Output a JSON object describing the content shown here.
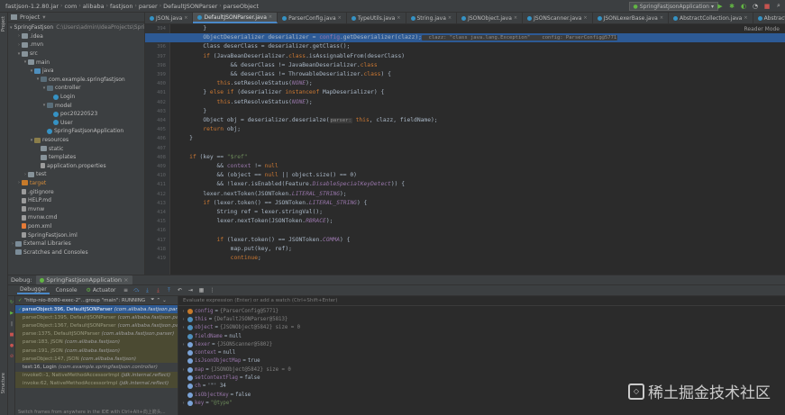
{
  "breadcrumbs": [
    "fastjson-1.2.80.jar",
    "com",
    "alibaba",
    "fastjson",
    "parser",
    "DefaultJSONParser",
    "parseObject"
  ],
  "run_config": "SpringFastjsonApplication",
  "toolbar_icons": [
    "run-icon",
    "debug-icon",
    "coverage-icon",
    "profile-icon",
    "stop-icon",
    "search-icon"
  ],
  "project": {
    "header": "Project",
    "rows": [
      {
        "indent": 0,
        "arrow": "▾",
        "icon": "folder",
        "label": "SpringFastjson",
        "extra": "C:\\Users\\admin\\IdeaProjects\\SpringFastjson"
      },
      {
        "indent": 1,
        "arrow": "›",
        "icon": "folder",
        "label": ".idea",
        "extra": ""
      },
      {
        "indent": 1,
        "arrow": "›",
        "icon": "folder",
        "label": ".mvn",
        "extra": ""
      },
      {
        "indent": 1,
        "arrow": "▾",
        "icon": "folder",
        "label": "src",
        "extra": ""
      },
      {
        "indent": 2,
        "arrow": "▾",
        "icon": "folder",
        "label": "main",
        "extra": ""
      },
      {
        "indent": 3,
        "arrow": "▾",
        "icon": "folder-src",
        "label": "java",
        "extra": ""
      },
      {
        "indent": 4,
        "arrow": "▾",
        "icon": "pkg",
        "label": "com.example.springfastjson",
        "extra": ""
      },
      {
        "indent": 5,
        "arrow": "▾",
        "icon": "pkg",
        "label": "controller",
        "extra": ""
      },
      {
        "indent": 6,
        "arrow": "",
        "icon": "cls",
        "label": "Login",
        "extra": ""
      },
      {
        "indent": 5,
        "arrow": "▾",
        "icon": "pkg",
        "label": "model",
        "extra": ""
      },
      {
        "indent": 6,
        "arrow": "",
        "icon": "cls",
        "label": "poc20220523",
        "extra": ""
      },
      {
        "indent": 6,
        "arrow": "",
        "icon": "cls",
        "label": "User",
        "extra": ""
      },
      {
        "indent": 5,
        "arrow": "",
        "icon": "cls",
        "label": "SpringFastjsonApplication",
        "extra": ""
      },
      {
        "indent": 3,
        "arrow": "▾",
        "icon": "folder-res",
        "label": "resources",
        "extra": ""
      },
      {
        "indent": 4,
        "arrow": "",
        "icon": "folder",
        "label": "static",
        "extra": ""
      },
      {
        "indent": 4,
        "arrow": "",
        "icon": "folder",
        "label": "templates",
        "extra": ""
      },
      {
        "indent": 4,
        "arrow": "",
        "icon": "file",
        "label": "application.properties",
        "extra": ""
      },
      {
        "indent": 2,
        "arrow": "›",
        "icon": "folder",
        "label": "test",
        "extra": ""
      },
      {
        "indent": 1,
        "arrow": "›",
        "icon": "folder-ex",
        "label": "target",
        "extra": ""
      },
      {
        "indent": 1,
        "arrow": "",
        "icon": "file",
        "label": ".gitignore",
        "extra": ""
      },
      {
        "indent": 1,
        "arrow": "",
        "icon": "file",
        "label": "HELP.md",
        "extra": ""
      },
      {
        "indent": 1,
        "arrow": "",
        "icon": "file",
        "label": "mvnw",
        "extra": ""
      },
      {
        "indent": 1,
        "arrow": "",
        "icon": "file",
        "label": "mvnw.cmd",
        "extra": ""
      },
      {
        "indent": 1,
        "arrow": "",
        "icon": "xml",
        "label": "pom.xml",
        "extra": ""
      },
      {
        "indent": 1,
        "arrow": "",
        "icon": "file",
        "label": "SpringFastjson.iml",
        "extra": ""
      },
      {
        "indent": 0,
        "arrow": "›",
        "icon": "lib",
        "label": "External Libraries",
        "extra": ""
      },
      {
        "indent": 0,
        "arrow": "",
        "icon": "lib",
        "label": "Scratches and Consoles",
        "extra": ""
      }
    ]
  },
  "tabs": [
    {
      "label": "JSON.java",
      "active": false,
      "kind": "cls"
    },
    {
      "label": "DefaultJSONParser.java",
      "active": true,
      "kind": "cls"
    },
    {
      "label": "ParserConfig.java",
      "active": false,
      "kind": "cls"
    },
    {
      "label": "TypeUtils.java",
      "active": false,
      "kind": "cls"
    },
    {
      "label": "String.java",
      "active": false,
      "kind": "cls"
    },
    {
      "label": "JSONObject.java",
      "active": false,
      "kind": "cls"
    },
    {
      "label": "JSONScanner.java",
      "active": false,
      "kind": "cls"
    },
    {
      "label": "JSONLexerBase.java",
      "active": false,
      "kind": "cls"
    },
    {
      "label": "AbstractCollection.java",
      "active": false,
      "kind": "cls"
    },
    {
      "label": "AbstractList.java",
      "active": false,
      "kind": "cls"
    }
  ],
  "editor": {
    "reader_mode": "Reader Mode",
    "lines": [
      {
        "num": "394",
        "hl": "",
        "segs": [
          [
            "",
            "        }"
          ]
        ]
      },
      {
        "num": "395",
        "hl": "hl",
        "segs": [
          [
            "",
            "        ObjectDeserializer deserializer = "
          ],
          [
            "fld",
            "config"
          ],
          [
            "",
            ".getDeserializer(clazz);"
          ],
          [
            "inlay",
            "  clazz: \"class java.lang.Exception\"    config: ParserConfig@5771"
          ]
        ]
      },
      {
        "num": "396",
        "hl": "",
        "segs": [
          [
            "",
            "        Class deserClass = deserializer.getClass();"
          ]
        ]
      },
      {
        "num": "397",
        "hl": "",
        "segs": [
          [
            "",
            "        "
          ],
          [
            "kw",
            "if"
          ],
          [
            "",
            " (JavaBeanDeserializer."
          ],
          [
            "kw",
            "class"
          ],
          [
            "",
            ".isAssignableFrom(deserClass)"
          ]
        ]
      },
      {
        "num": "398",
        "hl": "",
        "segs": [
          [
            "",
            "                && deserClass != JavaBeanDeserializer."
          ],
          [
            "kw",
            "class"
          ]
        ]
      },
      {
        "num": "399",
        "hl": "",
        "segs": [
          [
            "",
            "                && deserClass != ThrowableDeserializer."
          ],
          [
            "kw",
            "class"
          ],
          [
            "",
            ") {"
          ]
        ]
      },
      {
        "num": "400",
        "hl": "",
        "segs": [
          [
            "",
            "            "
          ],
          [
            "kw",
            "this"
          ],
          [
            "",
            ".setResolveStatus("
          ],
          [
            "ital",
            "NONE"
          ],
          [
            "",
            ");"
          ]
        ]
      },
      {
        "num": "401",
        "hl": "",
        "segs": [
          [
            "",
            "        } "
          ],
          [
            "kw",
            "else if"
          ],
          [
            "",
            " (deserializer "
          ],
          [
            "kw",
            "instanceof"
          ],
          [
            "",
            " MapDeserializer) {"
          ]
        ]
      },
      {
        "num": "402",
        "hl": "",
        "segs": [
          [
            "",
            "            "
          ],
          [
            "kw",
            "this"
          ],
          [
            "",
            ".setResolveStatus("
          ],
          [
            "ital",
            "NONE"
          ],
          [
            "",
            ");"
          ]
        ]
      },
      {
        "num": "403",
        "hl": "",
        "segs": [
          [
            "",
            "        }"
          ]
        ]
      },
      {
        "num": "404",
        "hl": "",
        "segs": [
          [
            "",
            "        Object obj = deserializer.deserialze("
          ],
          [
            "inlay",
            "parser:"
          ],
          [
            "",
            " "
          ],
          [
            "kw",
            "this"
          ],
          [
            "",
            ", clazz, fieldName);"
          ]
        ]
      },
      {
        "num": "405",
        "hl": "",
        "segs": [
          [
            "",
            "        "
          ],
          [
            "kw",
            "return"
          ],
          [
            "",
            " obj;"
          ]
        ]
      },
      {
        "num": "406",
        "hl": "",
        "segs": [
          [
            "",
            "    }"
          ]
        ]
      },
      {
        "num": "407",
        "hl": "",
        "segs": [
          [
            "",
            ""
          ]
        ]
      },
      {
        "num": "408",
        "hl": "",
        "segs": [
          [
            "",
            "    "
          ],
          [
            "kw",
            "if"
          ],
          [
            "",
            " (key == "
          ],
          [
            "str",
            "\"$ref\""
          ]
        ]
      },
      {
        "num": "409",
        "hl": "",
        "segs": [
          [
            "",
            "            && "
          ],
          [
            "fld",
            "context"
          ],
          [
            "",
            " != "
          ],
          [
            "kw",
            "null"
          ]
        ]
      },
      {
        "num": "410",
        "hl": "",
        "segs": [
          [
            "",
            "            && (object == "
          ],
          [
            "kw",
            "null"
          ],
          [
            "",
            " || object.size() == 0)"
          ]
        ]
      },
      {
        "num": "411",
        "hl": "",
        "segs": [
          [
            "",
            "            && !lexer.isEnabled(Feature."
          ],
          [
            "ital",
            "DisableSpecialKeyDetect"
          ],
          [
            "",
            ")) {"
          ]
        ]
      },
      {
        "num": "412",
        "hl": "",
        "segs": [
          [
            "",
            "        lexer.nextToken(JSONToken."
          ],
          [
            "ital",
            "LITERAL_STRING"
          ],
          [
            "",
            ");"
          ]
        ]
      },
      {
        "num": "413",
        "hl": "",
        "segs": [
          [
            "",
            "        "
          ],
          [
            "kw",
            "if"
          ],
          [
            "",
            " (lexer.token() == JSONToken."
          ],
          [
            "ital",
            "LITERAL_STRING"
          ],
          [
            "",
            ") {"
          ]
        ]
      },
      {
        "num": "414",
        "hl": "",
        "segs": [
          [
            "",
            "            String ref = lexer.stringVal();"
          ]
        ]
      },
      {
        "num": "415",
        "hl": "",
        "segs": [
          [
            "",
            "            lexer.nextToken(JSONToken."
          ],
          [
            "ital",
            "RBRACE"
          ],
          [
            "",
            ");"
          ]
        ]
      },
      {
        "num": "416",
        "hl": "",
        "segs": [
          [
            "",
            ""
          ]
        ]
      },
      {
        "num": "417",
        "hl": "",
        "segs": [
          [
            "",
            "            "
          ],
          [
            "kw",
            "if"
          ],
          [
            "",
            " (lexer.token() == JSONToken."
          ],
          [
            "ital",
            "COMMA"
          ],
          [
            "",
            ") {"
          ]
        ]
      },
      {
        "num": "418",
        "hl": "",
        "segs": [
          [
            "",
            "                map.put(key, ref);"
          ]
        ]
      },
      {
        "num": "419",
        "hl": "",
        "segs": [
          [
            "",
            "                "
          ],
          [
            "kw",
            "continue"
          ],
          [
            "",
            ";"
          ]
        ]
      }
    ]
  },
  "debug": {
    "label": "Debug:",
    "config_tab": "SpringFastjsonApplication",
    "tabs": [
      "Debugger",
      "Console",
      "Actuator"
    ],
    "thread": "\"http-nio-8080-exec-2\"...group \"main\": RUNNING",
    "frames": [
      {
        "text": "parseObject:396, DefaultJSONParser",
        "cls": "(com.alibaba.fastjson.parser)",
        "kind": "sel"
      },
      {
        "text": "parseObject:1395, DefaultJSONParser",
        "cls": "(com.alibaba.fastjson.parser)",
        "kind": "lib"
      },
      {
        "text": "parseObject:1367, DefaultJSONParser",
        "cls": "(com.alibaba.fastjson.parser)",
        "kind": "lib"
      },
      {
        "text": "parse:1375, DefaultJSONParser",
        "cls": "(com.alibaba.fastjson.parser)",
        "kind": "lib"
      },
      {
        "text": "parse:183, JSON",
        "cls": "(com.alibaba.fastjson)",
        "kind": "lib"
      },
      {
        "text": "parse:191, JSON",
        "cls": "(com.alibaba.fastjson)",
        "kind": "lib"
      },
      {
        "text": "parseObject:147, JSON",
        "cls": "(com.alibaba.fastjson)",
        "kind": "lib"
      },
      {
        "text": "test:16, Login",
        "cls": "(com.example.springfastjson.controller)",
        "kind": ""
      },
      {
        "text": "invoke0:-1, NativeMethodAccessorImpl",
        "cls": "(jdk.internal.reflect)",
        "kind": "lib"
      },
      {
        "text": "invoke:62, NativeMethodAccessorImpl",
        "cls": "(jdk.internal.reflect)",
        "kind": "lib"
      }
    ],
    "switch_hint": "Switch frames from anywhere in the IDE with Ctrl+Alt+向上箭头...",
    "eval_placeholder": "Evaluate expression (Enter) or add a watch (Ctrl+Shift+Enter)",
    "vars": [
      {
        "arrow": "›",
        "icon": "f",
        "name": "config",
        "value": "",
        "type": "{ParserConfig@5771}",
        "str": false
      },
      {
        "arrow": "›",
        "icon": "p",
        "name": "this",
        "value": "",
        "type": "{DefaultJSONParser@5813}",
        "str": false
      },
      {
        "arrow": "›",
        "icon": "p",
        "name": "object",
        "value": "",
        "type": "{JSONObject@5842}  size = 0",
        "str": false
      },
      {
        "arrow": "",
        "icon": "p",
        "name": "fieldName",
        "value": "null",
        "type": "",
        "str": false
      },
      {
        "arrow": "›",
        "icon": "l",
        "name": "lexer",
        "value": "",
        "type": "{JSONScanner@5802}",
        "str": false
      },
      {
        "arrow": "",
        "icon": "l",
        "name": "context",
        "value": "null",
        "type": "",
        "str": false
      },
      {
        "arrow": "",
        "icon": "l",
        "name": "isJsonObjectMap",
        "value": "true",
        "type": "",
        "str": false
      },
      {
        "arrow": "›",
        "icon": "l",
        "name": "map",
        "value": "",
        "type": "{JSONObject@5842}  size = 0",
        "str": false
      },
      {
        "arrow": "",
        "icon": "l",
        "name": "setContextFlag",
        "value": "false",
        "type": "",
        "str": false
      },
      {
        "arrow": "",
        "icon": "l",
        "name": "ch",
        "value": "'\"' 34",
        "type": "",
        "str": false
      },
      {
        "arrow": "",
        "icon": "l",
        "name": "isObjectKey",
        "value": "false",
        "type": "",
        "str": false
      },
      {
        "arrow": "›",
        "icon": "l",
        "name": "key",
        "value": "\"@type\"",
        "type": "",
        "str": true
      }
    ]
  },
  "watermark": "稀土掘金技术社区"
}
